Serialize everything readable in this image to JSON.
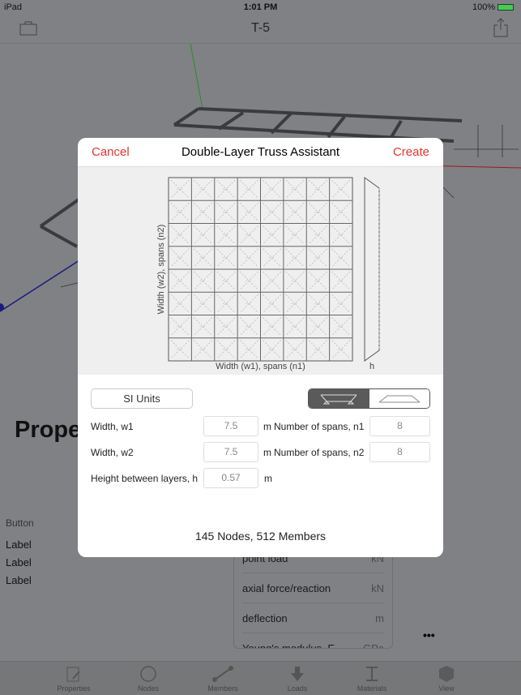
{
  "status": {
    "device": "iPad",
    "time": "1:01 PM",
    "battery": "100%"
  },
  "navbar": {
    "title": "T-5",
    "left_icon": "briefcase-icon",
    "right_icon": "share-icon"
  },
  "background": {
    "heading": "Prope",
    "button": "Button",
    "labels": [
      "Label",
      "Label",
      "Label"
    ],
    "table": [
      {
        "name": "point load",
        "unit": "kN"
      },
      {
        "name": "axial force/reaction",
        "unit": "kN"
      },
      {
        "name": "deflection",
        "unit": "m"
      },
      {
        "name": "Young's modulus, E",
        "unit": "GPa"
      }
    ],
    "more": "•••"
  },
  "tabbar": [
    {
      "label": "Properties",
      "icon": "notepad-icon"
    },
    {
      "label": "Nodes",
      "icon": "circle-icon"
    },
    {
      "label": "Members",
      "icon": "member-icon"
    },
    {
      "label": "Loads",
      "icon": "arrow-down-icon"
    },
    {
      "label": "Materials",
      "icon": "i-beam-icon"
    },
    {
      "label": "View",
      "icon": "cube-icon"
    }
  ],
  "modal": {
    "cancel": "Cancel",
    "title": "Double-Layer Truss Assistant",
    "create": "Create",
    "diagram": {
      "xlabel": "Width (w1), spans (n1)",
      "ylabel": "Width (w2), spans (n2)",
      "hlabel": "h"
    },
    "units_button": "SI Units",
    "support_options": [
      "bottom-supported",
      "top-supported"
    ],
    "selected_support": 0,
    "fields": [
      {
        "label": "Width, w1",
        "value": "7.5",
        "unit": "m",
        "span_label": "Number of spans, n1",
        "span_value": "8"
      },
      {
        "label": "Width, w2",
        "value": "7.5",
        "unit": "m",
        "span_label": "Number of spans, n2",
        "span_value": "8"
      },
      {
        "label": "Height between layers, h",
        "value": "0.57",
        "unit": "m"
      }
    ],
    "summary": "145 Nodes, 512 Members"
  },
  "colors": {
    "accent": "#e8332a",
    "overlay": "#808184"
  }
}
